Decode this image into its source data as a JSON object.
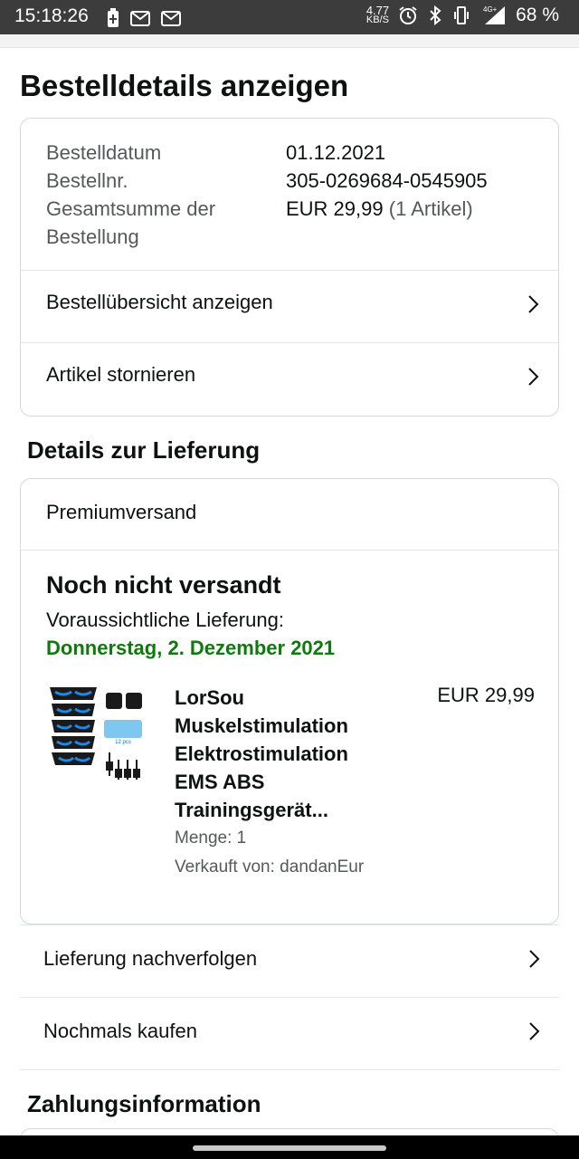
{
  "status_bar": {
    "time": "15:18:26",
    "net_speed_value": "4.77",
    "net_speed_unit": "KB/S",
    "network_type": "4G+",
    "battery": "68 %"
  },
  "page": {
    "title": "Bestelldetails anzeigen"
  },
  "order_summary": {
    "rows": [
      {
        "label": "Bestelldatum",
        "value": "01.12.2021"
      },
      {
        "label": "Bestellnr.",
        "value": "305-0269684-0545905"
      }
    ],
    "total_label_line1": "Gesamtsumme der",
    "total_label_line2": "Bestellung",
    "total_value": "EUR 29,99",
    "total_items": "(1 Artikel)",
    "links": [
      {
        "label": "Bestellübersicht anzeigen"
      },
      {
        "label": "Artikel stornieren"
      }
    ]
  },
  "delivery": {
    "section_title": "Details zur Lieferung",
    "shipping_method": "Premiumversand",
    "status": "Noch nicht versandt",
    "eta_label": "Voraussichtliche Lieferung:",
    "eta_date": "Donnerstag, 2. Dezember 2021",
    "product": {
      "title_lines": [
        "LorSou",
        "Muskelstimulation",
        "Elektrostimulation",
        "EMS ABS",
        "Trainingsgerät..."
      ],
      "price": "EUR 29,99",
      "quantity": "Menge: 1",
      "seller": "Verkauft von: dandanEur",
      "thumb_badge": "12 pcs"
    },
    "actions": [
      {
        "label": "Lieferung nachverfolgen"
      },
      {
        "label": "Nochmals kaufen"
      }
    ]
  },
  "payment": {
    "section_title": "Zahlungsinformation"
  },
  "colors": {
    "eta_green": "#0e7a0d",
    "status_bar_bg": "#3c3c3c",
    "border": "#d5d9d9"
  }
}
